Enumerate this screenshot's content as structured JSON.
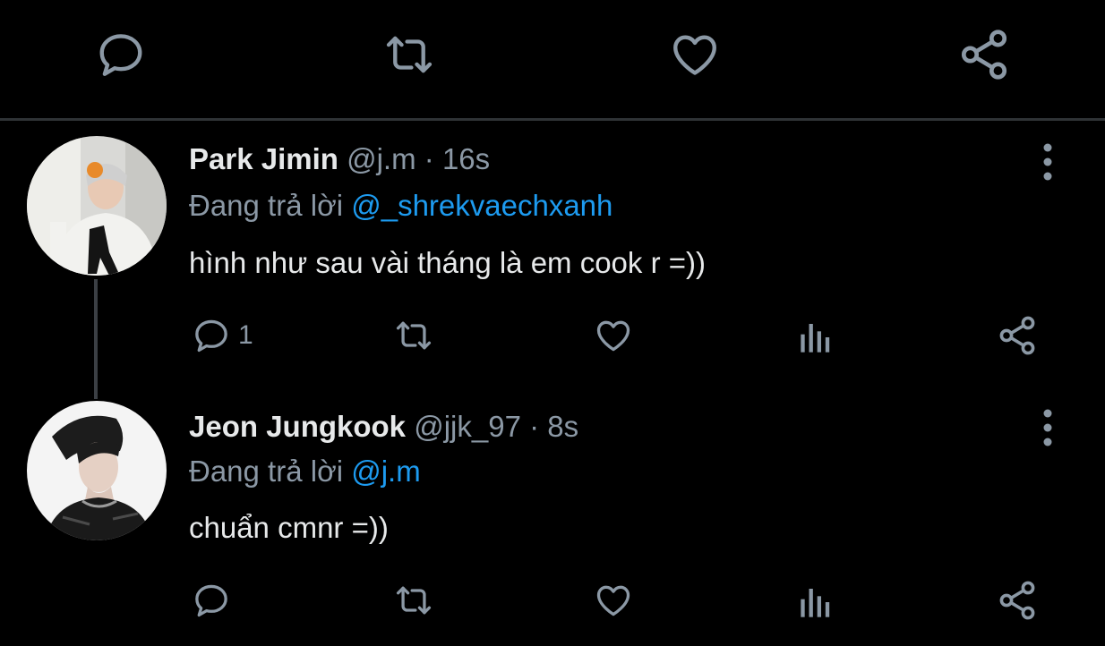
{
  "top_actions": {
    "reply_icon": "reply-icon",
    "retweet_icon": "retweet-icon",
    "like_icon": "heart-icon",
    "share_icon": "share-icon"
  },
  "tweets": [
    {
      "name": "Park Jimin",
      "handle": "@j.m",
      "separator": "·",
      "time": "16s",
      "reply_prefix": "Đang trả lời",
      "reply_to": "@_shrekvaechxanh",
      "text": "hình như sau vài tháng là em cook r =))",
      "reply_count": "1"
    },
    {
      "name": "Jeon Jungkook",
      "handle": "@jjk_97",
      "separator": "·",
      "time": "8s",
      "reply_prefix": "Đang trả lời",
      "reply_to": "@j.m",
      "text": "chuẩn cmnr =))",
      "reply_count": ""
    }
  ],
  "colors": {
    "background": "#000000",
    "primary_text": "#e7e9ea",
    "secondary_text": "#8b98a5",
    "accent": "#1d9bf0",
    "divider": "#2f3336"
  }
}
